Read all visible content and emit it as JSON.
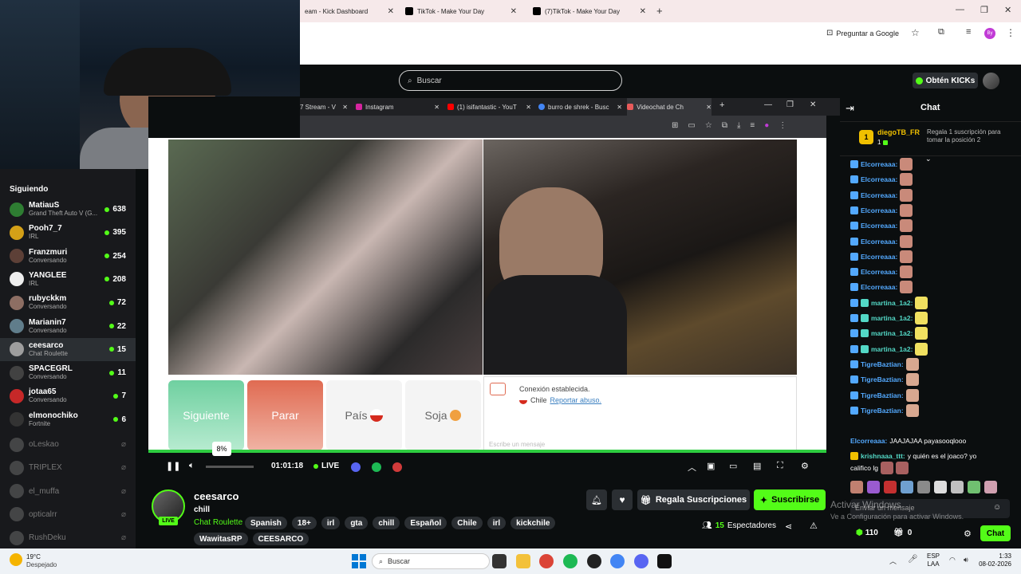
{
  "browser": {
    "tabs": [
      {
        "label": "eam - Kick Dashboard"
      },
      {
        "label": "TikTok - Make Your Day"
      },
      {
        "label": "(7)TikTok - Make Your Day"
      }
    ],
    "ask_google": "Preguntar a Google"
  },
  "kick": {
    "search_placeholder": "Buscar",
    "kicks_button": "Obtén KICKs"
  },
  "sidebar": {
    "heading": "Siguiendo",
    "items": [
      {
        "name": "MatiauS",
        "sub": "Grand Theft Auto V (G...",
        "count": "638"
      },
      {
        "name": "Pooh7_7",
        "sub": "IRL",
        "count": "395"
      },
      {
        "name": "Franzmuri",
        "sub": "Conversando",
        "count": "254"
      },
      {
        "name": "YANGLEE",
        "sub": "IRL",
        "count": "208"
      },
      {
        "name": "rubyckkm",
        "sub": "Conversando",
        "count": "72"
      },
      {
        "name": "Marianin7",
        "sub": "Conversando",
        "count": "22"
      },
      {
        "name": "ceesarco",
        "sub": "Chat Roulette",
        "count": "15"
      },
      {
        "name": "SPACEGRL",
        "sub": "Conversando",
        "count": "11"
      },
      {
        "name": "jotaa65",
        "sub": "Conversando",
        "count": "7"
      },
      {
        "name": "elmonochiko",
        "sub": "Fortnite",
        "count": "6"
      }
    ],
    "offline": [
      "oLeskao",
      "TRIPLEX",
      "el_muffa",
      "opticalrr",
      "RushDeku"
    ]
  },
  "inner_browser": {
    "tabs": [
      "7 Stream - V",
      "Instagram",
      "(1) isifantastic - YouT",
      "burro de shrek - Busc",
      "Videochat de Ch"
    ]
  },
  "videochat": {
    "next": "Siguiente",
    "stop": "Parar",
    "country": "País",
    "soy": "Soja",
    "connection": "Conexión establecida.",
    "country_name": "Chile",
    "report": "Reportar abuso.",
    "message_placeholder": "Escribe un mensaje"
  },
  "player": {
    "volume_pct": "8%",
    "time": "01:01:18",
    "live": "LIVE"
  },
  "stream": {
    "channel": "ceesarco",
    "title": "chill",
    "live_badge": "LIVE",
    "category": "Chat Roulette",
    "tags": [
      "Spanish",
      "18+",
      "irl",
      "gta",
      "chill",
      "Español",
      "Chile",
      "irl",
      "kickchile",
      "WawitasRP",
      "CEESARCO"
    ],
    "gift_button": "Regala Suscripciones",
    "subscribe_button": "Suscribirse",
    "viewers_count": "15",
    "viewers_label": "Espectadores"
  },
  "chat": {
    "title": "Chat",
    "pinned_user": "diegoTB_FR",
    "pinned_rank": "1",
    "pinned_count": "1",
    "pinned_text": "Regala 1 suscripción para tomar la posición 2",
    "messages": [
      {
        "user": "Elcorreaaa:",
        "color": "#53a9ff"
      },
      {
        "user": "Elcorreaaa:",
        "color": "#53a9ff"
      },
      {
        "user": "Elcorreaaa:",
        "color": "#53a9ff"
      },
      {
        "user": "Elcorreaaa:",
        "color": "#53a9ff"
      },
      {
        "user": "Elcorreaaa:",
        "color": "#53a9ff"
      },
      {
        "user": "Elcorreaaa:",
        "color": "#53a9ff"
      },
      {
        "user": "Elcorreaaa:",
        "color": "#53a9ff"
      },
      {
        "user": "Elcorreaaa:",
        "color": "#53a9ff"
      },
      {
        "user": "Elcorreaaa:",
        "color": "#53a9ff"
      },
      {
        "user": "martina_1a2:",
        "color": "#53d8c6"
      },
      {
        "user": "martina_1a2:",
        "color": "#53d8c6"
      },
      {
        "user": "martina_1a2:",
        "color": "#53d8c6"
      },
      {
        "user": "martina_1a2:",
        "color": "#53d8c6"
      },
      {
        "user": "TigreBaztian:",
        "color": "#53a9ff"
      },
      {
        "user": "TigreBaztian:",
        "color": "#53a9ff"
      },
      {
        "user": "TigreBaztian:",
        "color": "#53a9ff"
      },
      {
        "user": "TigreBaztian:",
        "color": "#53a9ff"
      }
    ],
    "msg_jaaja_user": "Elcorreaaa:",
    "msg_jaaja_text": "JAAJAJAA payasooqlooo",
    "msg_krish_user": "krishnaaa_ttt:",
    "msg_krish_text": "y quién es el joaco? yo",
    "msg_krish_text2": "califico lg",
    "input_placeholder": "Enviar un mensaje",
    "kicks": "110",
    "gift_count": "0",
    "send_button": "Chat"
  },
  "watermark": {
    "line1": "Activar Windows",
    "line2": "Ve a Configuración para activar Windows."
  },
  "taskbar": {
    "temp": "19°C",
    "weather": "Despejado",
    "search": "Buscar",
    "lang1": "ESP",
    "lang2": "LAA",
    "time": "1:33",
    "date": "08-02-2026"
  },
  "colors": {
    "kick_green": "#53fc18",
    "chat_blue": "#53a9ff"
  }
}
